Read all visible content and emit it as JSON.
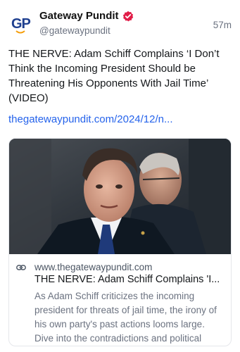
{
  "post": {
    "author": {
      "display_name": "Gateway Pundit",
      "handle": "@gatewaypundit",
      "avatar_text": "GP",
      "verified_icon": "verified-badge-icon"
    },
    "timestamp": "57m",
    "text": "THE NERVE: Adam Schiff Complains ‘I Don’t Think the Incoming President Should be Threatening His Opponents With Jail Time’ (VIDEO)",
    "link_text": "thegatewaypundit.com/2024/12/n..."
  },
  "link_card": {
    "link_icon": "link-icon",
    "domain": "www.thegatewaypundit.com",
    "title": "THE NERVE: Adam Schiff Complains 'I...",
    "description": "As Adam Schiff criticizes the incoming president for threats of jail time, the irony of his own party's past actions looms large. Dive into the contradictions and political maneuv..."
  },
  "colors": {
    "link": "#2563eb",
    "verified": "#e11d48",
    "brand": "#1e3f8f",
    "muted": "#6b7280"
  }
}
